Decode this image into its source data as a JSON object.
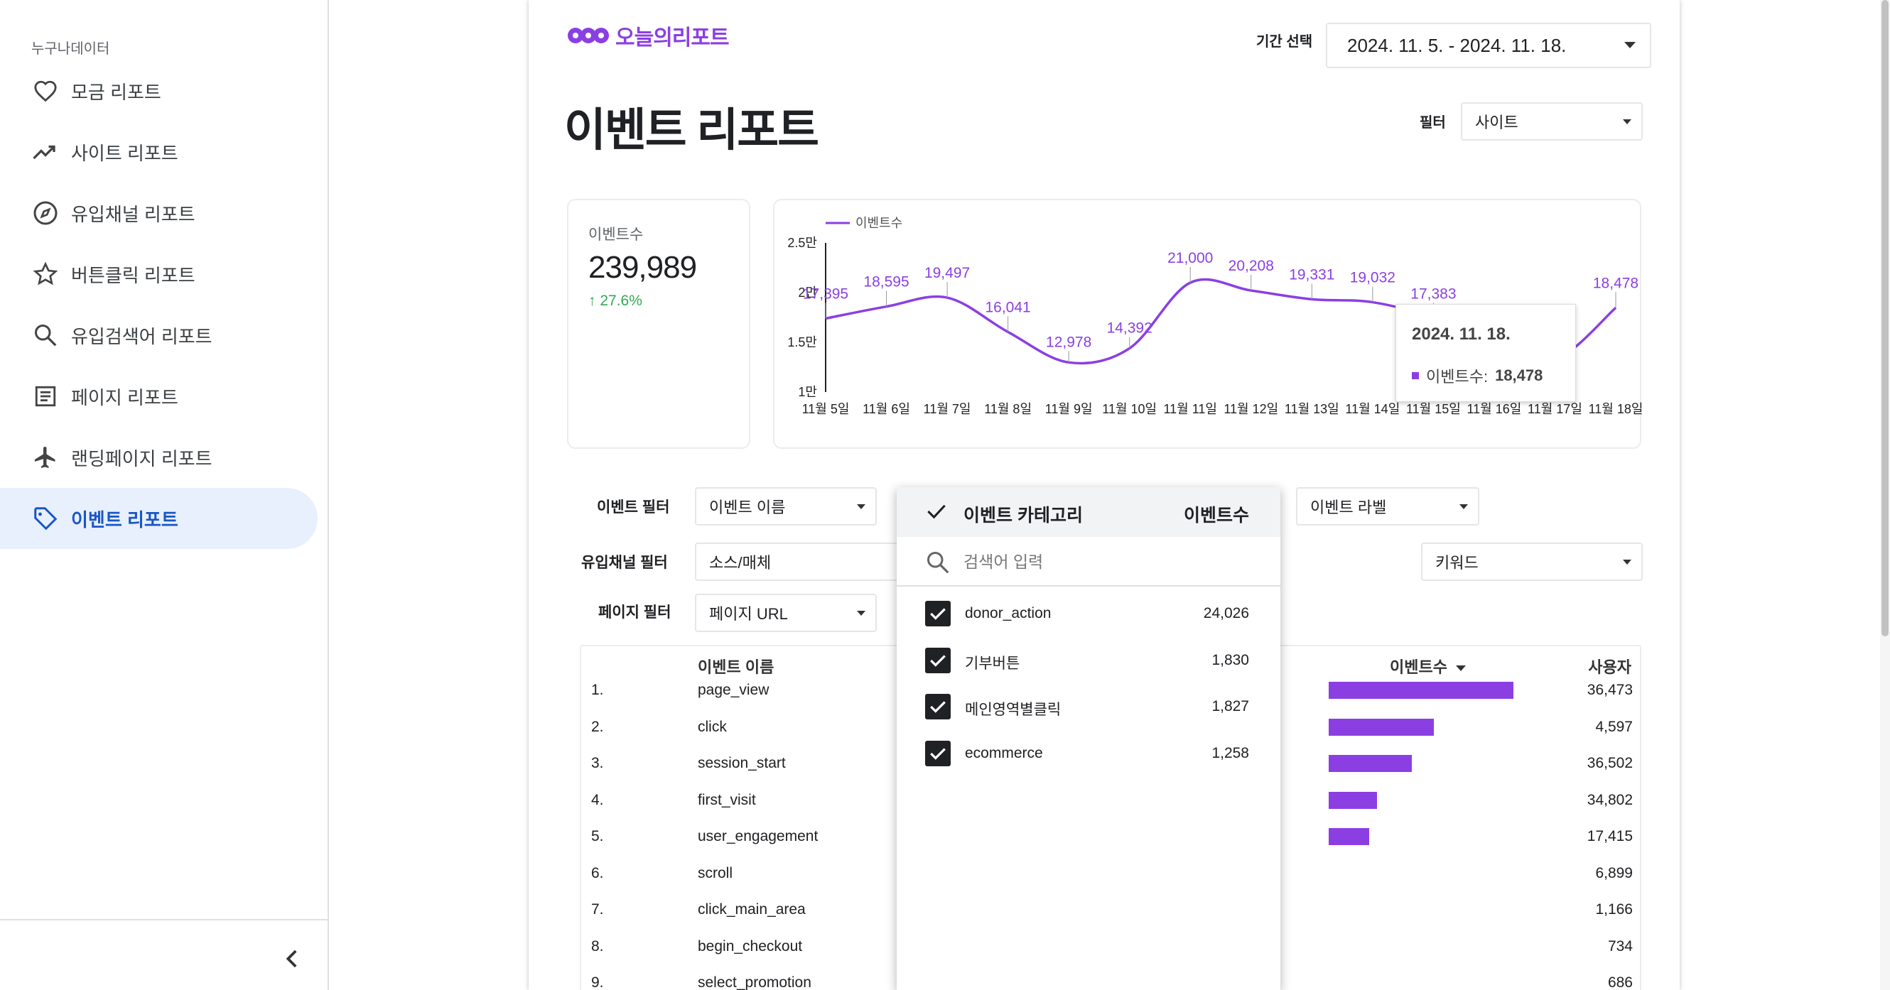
{
  "sidebar": {
    "org_name": "누구나데이터",
    "items": [
      {
        "label": "모금 리포트",
        "icon": "heart-icon"
      },
      {
        "label": "사이트 리포트",
        "icon": "trending-up-icon"
      },
      {
        "label": "유입채널 리포트",
        "icon": "compass-icon"
      },
      {
        "label": "버튼클릭 리포트",
        "icon": "star-icon"
      },
      {
        "label": "유입검색어 리포트",
        "icon": "search-icon"
      },
      {
        "label": "페이지 리포트",
        "icon": "document-icon"
      },
      {
        "label": "랜딩페이지 리포트",
        "icon": "airplane-icon"
      },
      {
        "label": "이벤트 리포트",
        "icon": "tag-icon",
        "active": true
      }
    ]
  },
  "header": {
    "logo_text": "오늘의리포트",
    "period_label": "기간 선택",
    "period_value": "2024. 11. 5. - 2024. 11. 18.",
    "title": "이벤트 리포트",
    "filter_label": "필터",
    "filter_value": "사이트"
  },
  "kpi": {
    "label": "이벤트수",
    "value": "239,989",
    "delta": "27.6%",
    "delta_color": "#34a853"
  },
  "chart_data": {
    "type": "line",
    "title": "",
    "legend": "이벤트수",
    "legend_position": "top-left",
    "color": "#8b3fe3",
    "categories": [
      "11월 5일",
      "11월 6일",
      "11월 7일",
      "11월 8일",
      "11월 9일",
      "11월 10일",
      "11월 11일",
      "11월 12일",
      "11월 13일",
      "11월 14일",
      "11월 15일",
      "11월 16일",
      "11월 17일",
      "11월 18일"
    ],
    "series": [
      {
        "name": "이벤트수",
        "values": [
          17395,
          18595,
          19497,
          16041,
          12978,
          14392,
          21000,
          20208,
          19331,
          19032,
          17383,
          14000,
          13200,
          18478
        ]
      }
    ],
    "data_labels": [
      "17,395",
      "18,595",
      "19,497",
      "16,041",
      "12,978",
      "14,392",
      "21,000",
      "20,208",
      "19,331",
      "19,032",
      "17,383",
      "",
      "",
      "18,478"
    ],
    "yticks": [
      "2.5만",
      "2만",
      "1.5만",
      "1만"
    ],
    "ylim": [
      10000,
      25000
    ]
  },
  "tooltip": {
    "date": "2024. 11. 18.",
    "series": "이벤트수:",
    "value": "18,478"
  },
  "filters": {
    "event_label": "이벤트 필터",
    "event_name": "이벤트 이름",
    "event_tag": "이벤트 라벨",
    "channel_label": "유입채널 필터",
    "source_medium": "소스/매체",
    "keyword": "키워드",
    "page_label": "페이지 필터",
    "page_url": "페이지 URL"
  },
  "table": {
    "col_name": "이벤트 이름",
    "col_count": "이벤트수",
    "col_users": "사용자",
    "rows": [
      {
        "idx": "1.",
        "name": "page_view",
        "bar": 1.0,
        "users": "36,473"
      },
      {
        "idx": "2.",
        "name": "click",
        "bar": 0.57,
        "users": "4,597"
      },
      {
        "idx": "3.",
        "name": "session_start",
        "bar": 0.45,
        "users": "36,502"
      },
      {
        "idx": "4.",
        "name": "first_visit",
        "bar": 0.26,
        "users": "34,802"
      },
      {
        "idx": "5.",
        "name": "user_engagement",
        "bar": 0.22,
        "users": "17,415"
      },
      {
        "idx": "6.",
        "name": "scroll",
        "bar": 0,
        "users": "6,899"
      },
      {
        "idx": "7.",
        "name": "click_main_area",
        "bar": 0,
        "users": "1,166"
      },
      {
        "idx": "8.",
        "name": "begin_checkout",
        "bar": 0,
        "users": "734"
      },
      {
        "idx": "9.",
        "name": "select_promotion",
        "bar": 0,
        "users": "686"
      }
    ]
  },
  "dropdown": {
    "header_label": "이벤트 카테고리",
    "header_count": "이벤트수",
    "search_placeholder": "검색어 입력",
    "items": [
      {
        "label": "donor_action",
        "count": "24,026"
      },
      {
        "label": "기부버튼",
        "count": "1,830"
      },
      {
        "label": "메인영역별클릭",
        "count": "1,827"
      },
      {
        "label": "ecommerce",
        "count": "1,258"
      }
    ]
  }
}
